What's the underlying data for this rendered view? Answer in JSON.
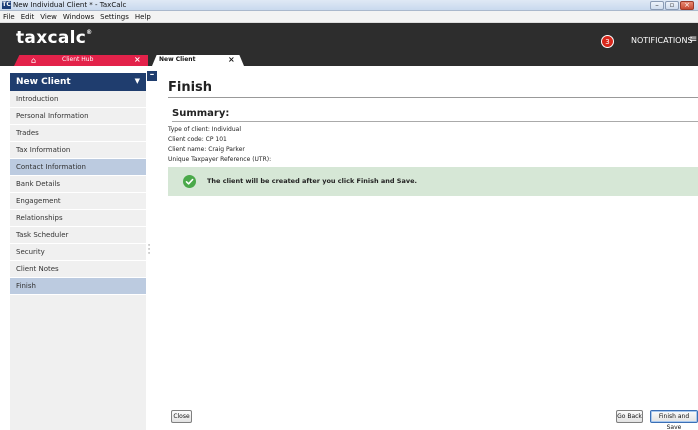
{
  "window": {
    "app_icon": "TC",
    "title": "New Individual Client * - TaxCalc",
    "controls": [
      "minimize",
      "maximize",
      "close"
    ]
  },
  "menubar": [
    "File",
    "Edit",
    "View",
    "Windows",
    "Settings",
    "Help"
  ],
  "header": {
    "logo": "taxcalc",
    "logo_mark": "®",
    "notification_count": "3",
    "notifications_label": "NOTIFICATIONS",
    "menu_icon": "hamburger-icon"
  },
  "tabs": {
    "home_label": "Client Hub",
    "active_label": "New Client",
    "close_glyph": "×"
  },
  "sidebar": {
    "title": "New Client",
    "items": [
      {
        "label": "Introduction"
      },
      {
        "label": "Personal Information"
      },
      {
        "label": "Trades"
      },
      {
        "label": "Tax Information"
      },
      {
        "label": "Contact Information"
      },
      {
        "label": "Bank Details"
      },
      {
        "label": "Engagement"
      },
      {
        "label": "Relationships"
      },
      {
        "label": "Task Scheduler"
      },
      {
        "label": "Security"
      },
      {
        "label": "Client Notes"
      },
      {
        "label": "Finish"
      }
    ]
  },
  "main": {
    "title": "Finish",
    "summary_title": "Summary:",
    "lines": [
      "Type of client: Individual",
      "Client code: CP 101",
      "Client name: Craig Parker",
      "Unique Taxpayer Reference (UTR):"
    ],
    "banner_text": "The client will be created after you click Finish and Save.",
    "buttons": {
      "close": "Close",
      "go_back": "Go Back",
      "finish_save": "Finish and Save"
    }
  },
  "colors": {
    "header_bg": "#2d2d2d",
    "home_tab": "#e3224a",
    "sidebar_header": "#1f3d6e",
    "nav_highlight": "#bccbe0",
    "banner_bg": "#d6e7d6",
    "check_green": "#4aa94a",
    "badge_red": "#d8281c"
  }
}
